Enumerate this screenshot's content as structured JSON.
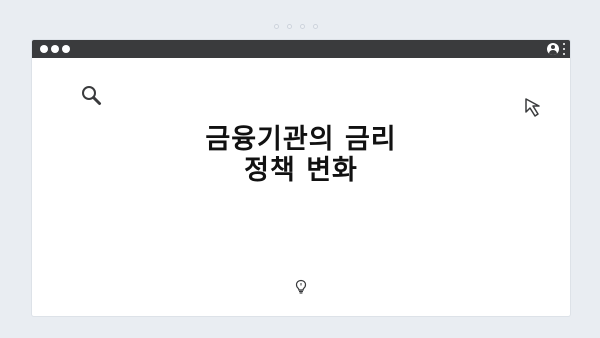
{
  "carousel": {
    "dots": 4
  },
  "window": {
    "controls": [
      "close",
      "minimize",
      "maximize"
    ]
  },
  "icons": {
    "search": "search-icon",
    "cursor": "cursor-icon",
    "user": "user-icon",
    "menu": "kebab-menu-icon",
    "bulb": "lightbulb-icon"
  },
  "content": {
    "title_line1": "금융기관의 금리",
    "title_line2": "정책 변화"
  },
  "colors": {
    "background": "#e9edf2",
    "titlebar": "#3a3b3d",
    "text": "#111111"
  }
}
